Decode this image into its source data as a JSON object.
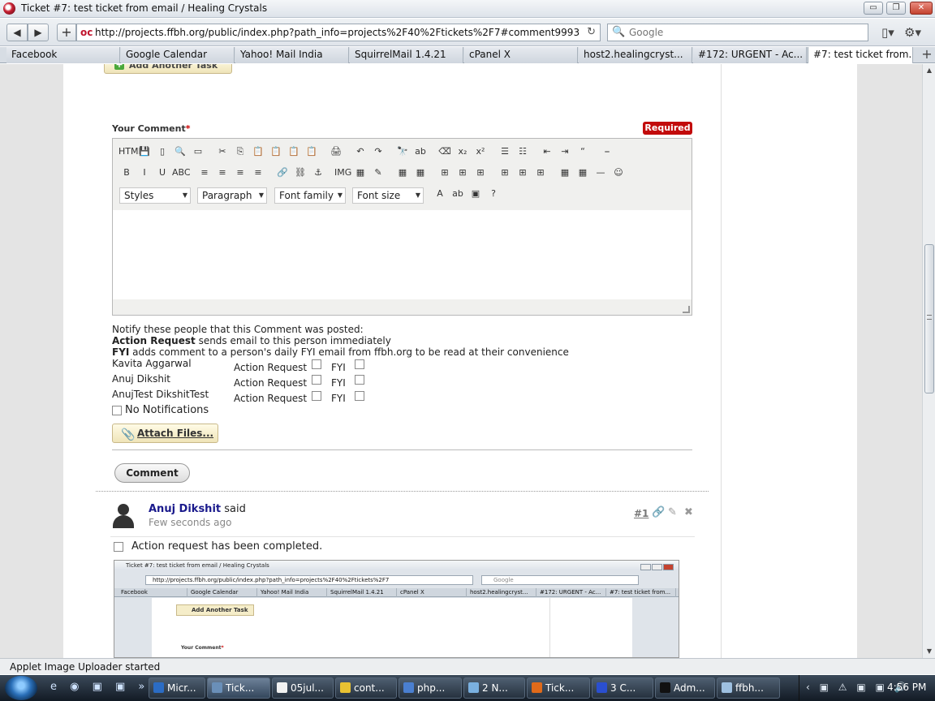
{
  "window": {
    "title": "Ticket #7: test ticket from email / Healing Crystals",
    "min_label": "▭",
    "max_label": "❐",
    "close_label": "✕"
  },
  "toolbar": {
    "back_icon": "◀",
    "forward_icon": "▶",
    "newtab_icon": "+",
    "url": "http://projects.ffbh.org/public/index.php?path_info=projects%2F40%2Ftickets%2F7#comment9993",
    "favicon": "oc",
    "reload_icon": "↻",
    "search_placeholder": "Google",
    "search_icon": "🔍",
    "page_icon": "▯▾",
    "tools_icon": "⚙▾"
  },
  "tabs": [
    {
      "label": "Facebook"
    },
    {
      "label": "Google Calendar"
    },
    {
      "label": "Yahoo! Mail India"
    },
    {
      "label": "SquirrelMail 1.4.21"
    },
    {
      "label": "cPanel X"
    },
    {
      "label": "host2.healingcryst..."
    },
    {
      "label": "#172: URGENT - Ac..."
    },
    {
      "label": "#7: test ticket from..."
    }
  ],
  "tab_add": "+",
  "page": {
    "add_task": "Add Another Task",
    "comment_label": "Your Comment",
    "required_star": "*",
    "required_badge": "Required",
    "editor": {
      "row1": [
        "HTML",
        "💾",
        "▯",
        "🔍",
        "▭",
        "|",
        "✂",
        "⎘",
        "📋",
        "📋",
        "📋",
        "📋",
        "|",
        "🖨",
        "|",
        "↶",
        "↷",
        "|",
        "🔭",
        "ab",
        "|",
        "⌫",
        "x₂",
        "x²",
        "|",
        "☰",
        "☷",
        "|",
        "⇤",
        "⇥",
        "“",
        "|",
        "⎯"
      ],
      "row2": [
        "B",
        "I",
        "U",
        "ABC",
        "|",
        "≡",
        "≡",
        "≡",
        "≡",
        "|",
        "🔗",
        "⛓",
        "⚓",
        "|",
        "IMG",
        "▦",
        "✎",
        "|",
        "▦",
        "▦",
        "|",
        "⊞",
        "⊞",
        "⊞",
        "|",
        "⊞",
        "⊞",
        "⊞",
        "|",
        "▦",
        "▦",
        "—",
        "☺"
      ],
      "selects": {
        "styles": "Styles",
        "format": "Paragraph",
        "font_family": "Font family",
        "font_size": "Font size"
      },
      "row3_icons": [
        "A",
        "ab",
        "▣",
        "?"
      ]
    },
    "notify": {
      "intro": "Notify these people that this Comment was posted:",
      "action_bold": "Action Request",
      "action_rest": " sends email to this person immediately",
      "fyi_bold": "FYI",
      "fyi_rest": " adds comment to a person's daily FYI email from ffbh.org to be read at their convenience",
      "people": [
        {
          "name": "Kavita Aggarwal",
          "action_label": "Action Request",
          "fyi_label": "FYI"
        },
        {
          "name": "Anuj Dikshit",
          "action_label": "Action Request",
          "fyi_label": "FYI"
        },
        {
          "name": "AnujTest DikshitTest",
          "action_label": "Action Request",
          "fyi_label": "FYI"
        }
      ],
      "no_notifications": "No Notifications"
    },
    "attach_files": "Attach Files...",
    "comment_button": "Comment",
    "comment": {
      "author": "Anuj Dikshit",
      "said": " said",
      "when": "Few seconds ago",
      "number": "#1",
      "completed_label": "Action request has been completed."
    },
    "thumbnail": {
      "title": "Ticket #7: test ticket from email / Healing Crystals",
      "url": "http://projects.ffbh.org/public/index.php?path_info=projects%2F40%2Ftickets%2F7",
      "search": "Google",
      "tabs": [
        "Facebook",
        "Google Calendar",
        "Yahoo! Mail India",
        "SquirrelMail 1.4.21",
        "cPanel X",
        "host2.healingcryst...",
        "#172: URGENT - Ac...",
        "#7: test ticket from..."
      ],
      "add_task": "Add Another Task",
      "comment_label": "Your Comment",
      "required_star": "*"
    }
  },
  "statusbar": {
    "text": "Applet Image Uploader started"
  },
  "taskbar": {
    "quicklaunch": "e ◉ ▣ ▣ »",
    "tasks": [
      {
        "label": "Micr...",
        "color": "#2b6cc4"
      },
      {
        "label": "Tick...",
        "color": "#6a8fb8"
      },
      {
        "label": "05jul...",
        "color": "#f2f2f2"
      },
      {
        "label": "cont...",
        "color": "#e8c232"
      },
      {
        "label": "php...",
        "color": "#4a7fd0"
      },
      {
        "label": "2 N...",
        "color": "#7ab0e0"
      },
      {
        "label": "Tick...",
        "color": "#e06a1a"
      },
      {
        "label": "3 C...",
        "color": "#2a4fd0"
      },
      {
        "label": "Adm...",
        "color": "#111111"
      },
      {
        "label": "ffbh...",
        "color": "#9ec0e0"
      }
    ],
    "tray_icons": "‹ ▣ ⚠ ▣ ▣ 🔊",
    "clock": "4:56 PM"
  }
}
